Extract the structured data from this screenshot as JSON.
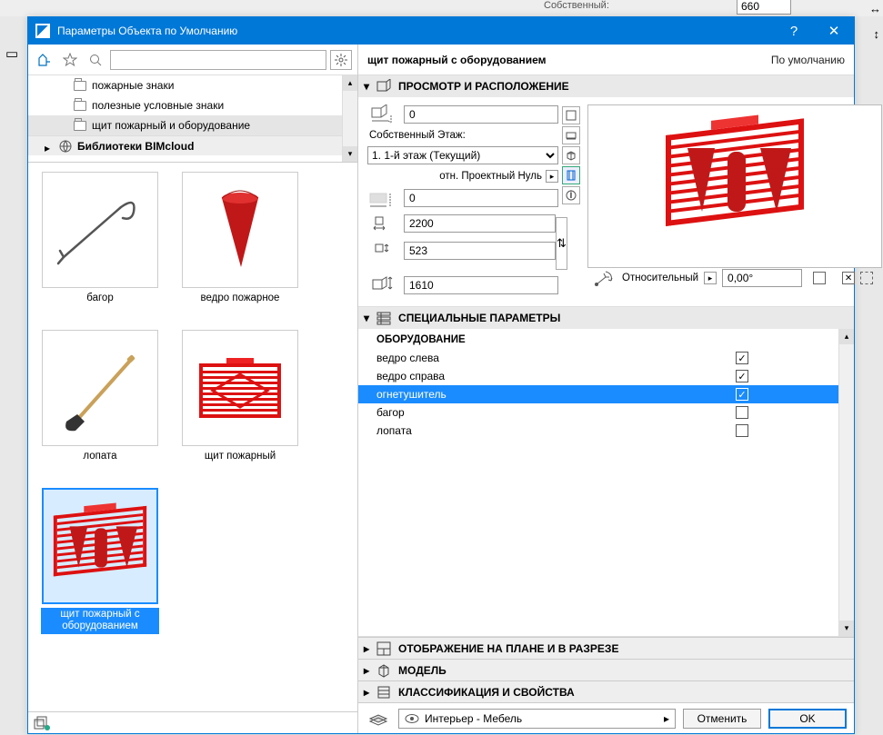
{
  "bg": {
    "label": "Собственный:",
    "value": "660"
  },
  "title": "Параметры Объекта по Умолчанию",
  "tree": {
    "items": [
      {
        "label": "пожарные знаки"
      },
      {
        "label": "полезные условные знаки"
      },
      {
        "label": "щит пожарный и оборудование"
      }
    ],
    "lib": "Библиотеки BIMcloud"
  },
  "gallery": [
    {
      "label": "багор"
    },
    {
      "label": "ведро пожарное"
    },
    {
      "label": "лопата"
    },
    {
      "label": "щит пожарный"
    },
    {
      "label": "щит пожарный с оборудованием"
    }
  ],
  "right": {
    "name": "щит пожарный с оборудованием",
    "defset": "По умолчанию"
  },
  "sections": {
    "preview": "ПРОСМОТР И РАСПОЛОЖЕНИЕ",
    "special": "СПЕЦИАЛЬНЫЕ ПАРАМЕТРЫ",
    "plan": "ОТОБРАЖЕНИЕ НА ПЛАНЕ И В РАЗРЕЗЕ",
    "model": "МОДЕЛЬ",
    "class": "КЛАССИФИКАЦИЯ И СВОЙСТВА"
  },
  "preview": {
    "top_offset": "0",
    "floor_label": "Собственный Этаж:",
    "floor": "1. 1-й этаж (Текущий)",
    "proj_label": "отн. Проектный Нуль",
    "proj_value": "0",
    "width": "2200",
    "depth": "523",
    "height": "1610",
    "rel_label": "Относительный",
    "angle": "0,00°"
  },
  "special": {
    "head": "ОБОРУДОВАНИЕ",
    "rows": [
      {
        "label": "ведро слева",
        "checked": true
      },
      {
        "label": "ведро справа",
        "checked": true
      },
      {
        "label": "огнетушитель",
        "checked": true,
        "selected": true
      },
      {
        "label": "багор",
        "checked": false
      },
      {
        "label": "лопата",
        "checked": false
      }
    ]
  },
  "footer": {
    "layer": "Интерьер - Мебель",
    "cancel": "Отменить",
    "ok": "OK"
  }
}
